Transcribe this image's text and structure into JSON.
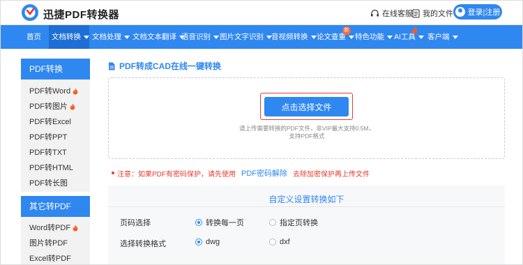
{
  "header": {
    "brand": "迅捷PDF转换器",
    "service_label": "在线客服",
    "myfiles_label": "我的文件",
    "login_label": "登录|注册"
  },
  "nav": {
    "items": [
      {
        "label": "首页"
      },
      {
        "label": "文档转换"
      },
      {
        "label": "文档处理"
      },
      {
        "label": "文档文本翻译"
      },
      {
        "label": "语音识别"
      },
      {
        "label": "图片文字识别"
      },
      {
        "label": "音视频转换"
      },
      {
        "label": "论文查重"
      },
      {
        "label": "特色功能"
      },
      {
        "label": "AI工具"
      },
      {
        "label": "客户端"
      }
    ],
    "new_badge": "新"
  },
  "sidebar": {
    "group1_title": "PDF转换",
    "group1_items": [
      {
        "label": "PDF转Word",
        "hot": true
      },
      {
        "label": "PDF转图片",
        "hot": true
      },
      {
        "label": "PDF转Excel",
        "hot": false
      },
      {
        "label": "PDF转PPT",
        "hot": false
      },
      {
        "label": "PDF转TXT",
        "hot": false
      },
      {
        "label": "PDF转HTML",
        "hot": false
      },
      {
        "label": "PDF转长图",
        "hot": false
      }
    ],
    "group2_title": "其它转PDF",
    "group2_items": [
      {
        "label": "Word转PDF",
        "hot": true
      },
      {
        "label": "图片转PDF",
        "hot": false
      },
      {
        "label": "Excel转PDF",
        "hot": false
      }
    ]
  },
  "main": {
    "title": "PDF转成CAD在线一键转换",
    "choose_label": "点击选择文件",
    "hint_line1": "请上传需要转换的PDF文件，非VIP最大支持0.5M，",
    "hint_line2": "支持PDF格式",
    "notice_prefix": "注意：如果PDF有密码保护，请先使用",
    "notice_link": "PDF密码解除",
    "notice_suffix": "去除加密保护再上传文件"
  },
  "settings": {
    "title": "自定义设置转换如下",
    "page_label": "页码选择",
    "page_option_1": "转换每一页",
    "page_option_2": "指定页转换",
    "format_label": "选择转换格式",
    "format_option_1": "dwg",
    "format_option_2": "dxf"
  },
  "colors": {
    "primary": "#2f87f0",
    "active_nav": "#1d6fd6",
    "warning": "#e23b2e",
    "hot": "#ff6a3d"
  }
}
